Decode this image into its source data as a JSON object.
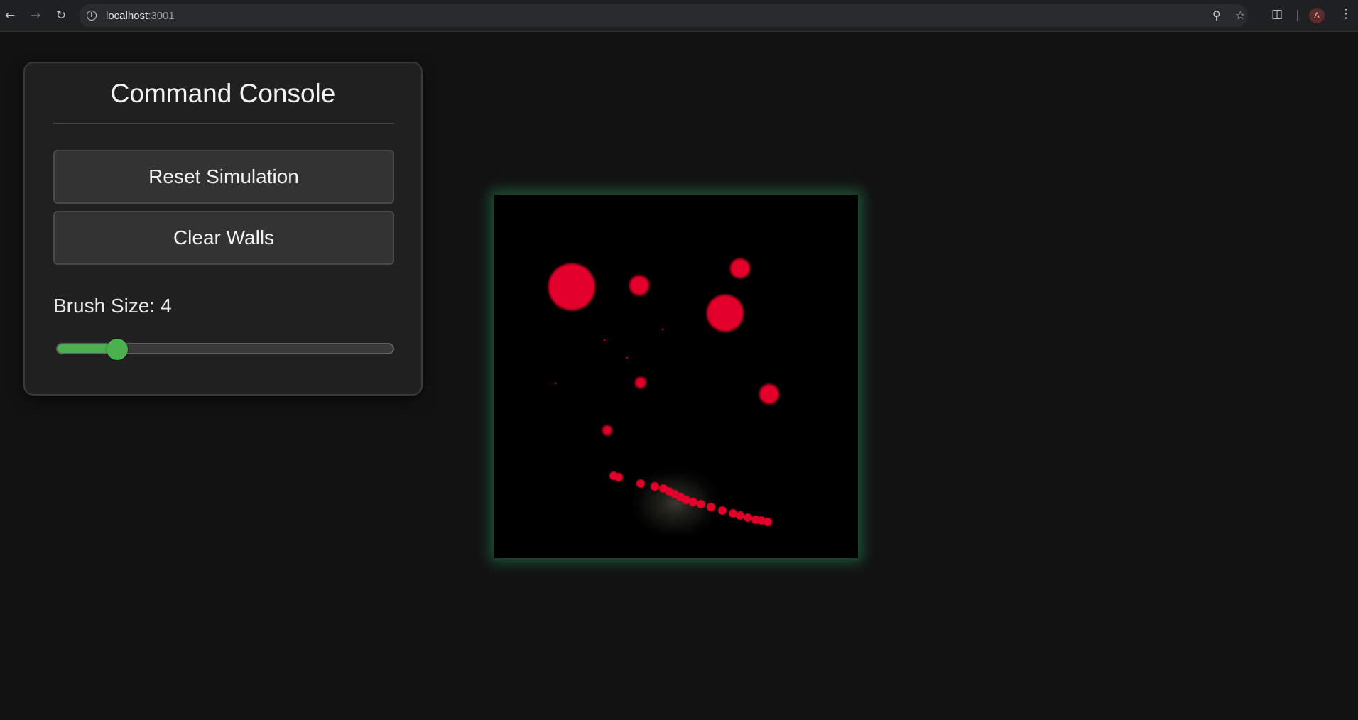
{
  "browser": {
    "url_host": "localhost",
    "url_port": ":3001",
    "icons": {
      "back": "back-arrow-icon",
      "forward": "forward-arrow-icon",
      "reload": "reload-icon",
      "site_info": "info-icon",
      "zoom": "zoom-icon",
      "bookmark": "star-icon",
      "extensions": "puzzle-icon",
      "menu": "kebab-menu-icon"
    },
    "profile_initial": "A"
  },
  "console": {
    "title": "Command Console",
    "reset_label": "Reset Simulation",
    "clear_label": "Clear Walls",
    "brush_label": "Brush Size: 4",
    "brush_value": 4,
    "brush_fraction": 0.18
  },
  "colors": {
    "page_bg": "#121212",
    "panel_bg": "#202020",
    "accent_green": "#4caf50",
    "particle_red": "#e3002a",
    "canvas_glow": "#288c55"
  }
}
